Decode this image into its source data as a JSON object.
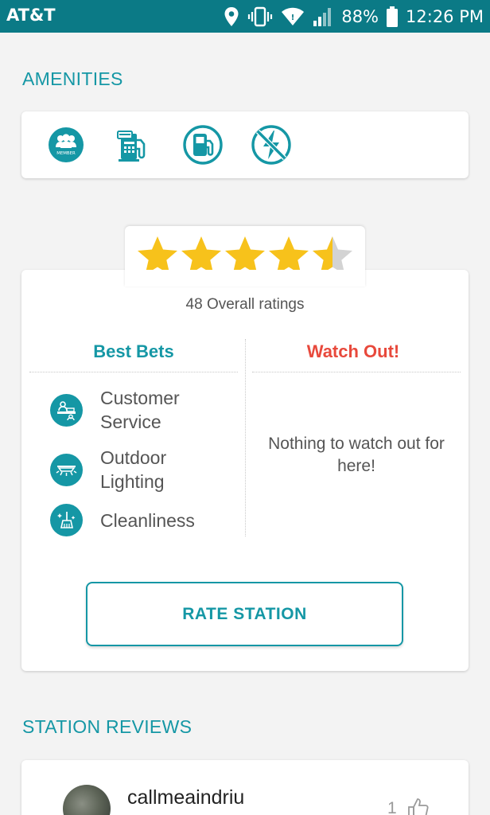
{
  "status_bar": {
    "carrier": "AT&T",
    "battery": "88%",
    "time": "12:26 PM",
    "icons": [
      "location-icon",
      "vibrate-icon",
      "wifi-icon",
      "signal-icon",
      "battery-icon"
    ]
  },
  "amenities": {
    "title": "AMENITIES",
    "icons": [
      "member-icon",
      "pay-at-pump-icon",
      "fuel-pump-icon",
      "no-electric-charging-icon"
    ],
    "member_text": "MEMBER"
  },
  "rating": {
    "stars": 4.5,
    "overall_text": "48 Overall ratings",
    "best_bets_title": "Best Bets",
    "watch_out_title": "Watch Out!",
    "best_bets": [
      {
        "label": "Customer Service",
        "icon": "customer-service-icon"
      },
      {
        "label": "Outdoor Lighting",
        "icon": "outdoor-lighting-icon"
      },
      {
        "label": "Cleanliness",
        "icon": "cleanliness-icon"
      }
    ],
    "watch_out_empty": "Nothing to watch out for here!",
    "rate_button": "RATE STATION"
  },
  "reviews": {
    "title": "STATION REVIEWS",
    "items": [
      {
        "username": "callmeaindriu",
        "likes": "1"
      }
    ]
  },
  "colors": {
    "accent": "#1597a5",
    "status_bar": "#0b7a86",
    "watch_out": "#e8493c",
    "star": "#f7c21b"
  }
}
